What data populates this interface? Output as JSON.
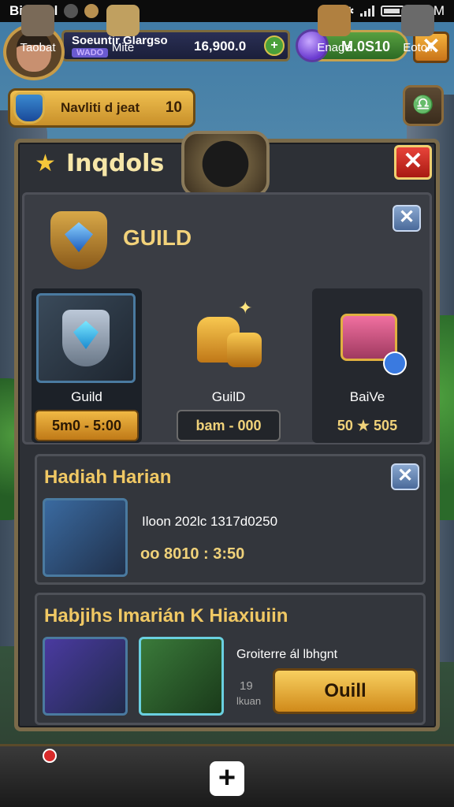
{
  "status_bar": {
    "app_name": "Biadgal",
    "time": "189M"
  },
  "top_bar": {
    "player_name": "Soeuntir Glargso",
    "player_sub": "WADO",
    "exp_value": "16,900.0",
    "gem_value": "M.0S10"
  },
  "quest_bar": {
    "label": "Navliti d jeat",
    "count": "10"
  },
  "panel": {
    "title": "Inqdols",
    "guild_heading": "GUILD",
    "cards": [
      {
        "label": "Guild",
        "price": "5m0 - 5:00"
      },
      {
        "label": "GuilD",
        "price": "bam - 000"
      },
      {
        "label": "BaiVe",
        "price": "50 ★ 505"
      }
    ],
    "daily": {
      "title": "Hadiah Harian",
      "info": "Iloon 202lc 1317d0250",
      "reward": "oo 8010 : 3:50"
    },
    "weekly": {
      "title": "Habjihs Imarián K Hiaxiuiin",
      "info": "Groiterre ál lbhgnt",
      "side_num": "19",
      "side_text": "lkuan",
      "button": "Ouill"
    }
  },
  "bottom_nav": [
    {
      "label": "Taobat"
    },
    {
      "label": "Mite"
    },
    {
      "label": ""
    },
    {
      "label": "Enage"
    },
    {
      "label": "Eotoii"
    }
  ],
  "colors": {
    "gold": "#f0c864",
    "panel": "#2d3036",
    "accent_blue": "#4a7aa0"
  }
}
